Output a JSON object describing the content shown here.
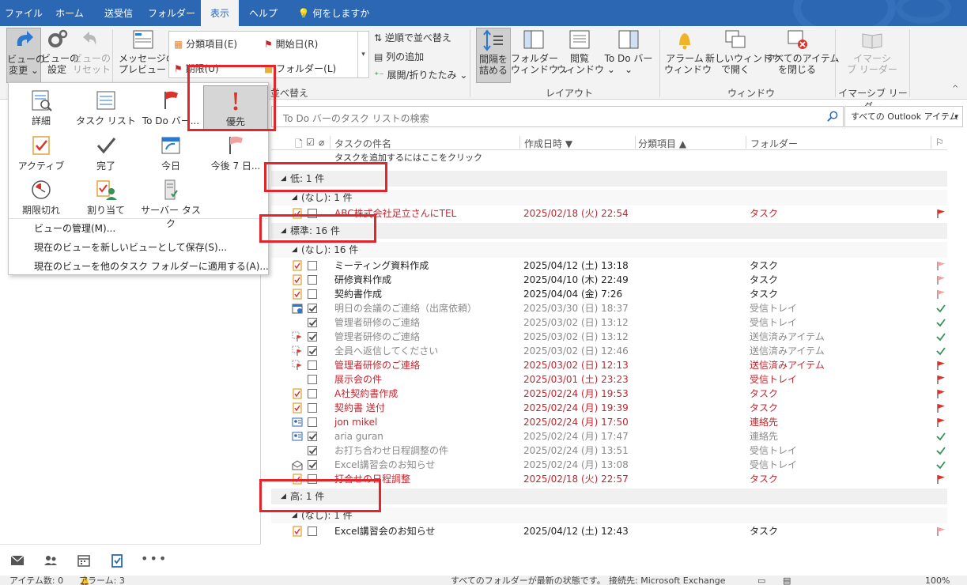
{
  "tabs": [
    "ファイル",
    "ホーム",
    "送受信",
    "フォルダー",
    "表示",
    "ヘルプ",
    "何をしますか"
  ],
  "ribbon": {
    "change_view": "ビューの\n変更 ⌄",
    "view_settings": "ビューの\n設定",
    "reset_view": "ビューの\nリセット",
    "message_preview": "メッセージの\nプレビュー ⌄",
    "arrangement": {
      "category": "分類項目(E)",
      "start_date": "開始日(R)",
      "due_date": "期限(U)",
      "folder": "フォルダー(L)"
    },
    "reverse_sort": "逆順で並べ替え",
    "add_columns": "列の追加",
    "expand_collapse": "展開/折りたたみ ⌄",
    "group_arrangement": "並べ替え",
    "compact": "間隔を\n詰める",
    "folder_pane": "フォルダー\nウィンドウ ⌄",
    "reading_pane": "閲覧\nウィンドウ ⌄",
    "todo_bar": "To Do バー\n⌄",
    "group_layout": "レイアウト",
    "reminders": "アラーム\nウィンドウ",
    "open_new_window": "新しいウィンドウ\nで開く",
    "close_all": "すべてのアイテム\nを閉じる",
    "group_window": "ウィンドウ",
    "immersive_reader": "イマーシ\nブ リーダー",
    "group_immersive": "イマーシブ リーダー"
  },
  "dropdown": {
    "items": [
      "詳細",
      "タスク リスト",
      "To Do バー...",
      "優先",
      "アクティブ",
      "完了",
      "今日",
      "今後 7 日...",
      "期限切れ",
      "割り当て",
      "サーバー タスク"
    ],
    "manage": "ビューの管理(M)...",
    "save_as": "現在のビューを新しいビューとして保存(S)...",
    "apply": "現在のビューを他のタスク フォルダーに適用する(A)..."
  },
  "search": {
    "placeholder": "To Do バーのタスク リストの検索",
    "scope": "すべての Outlook アイテム"
  },
  "columns": {
    "subject": "タスクの件名",
    "created": "作成日時",
    "category": "分類項目",
    "folder": "フォルダー"
  },
  "add_task": "タスクを追加するにはここをクリック",
  "groups": [
    {
      "label": "低: 1 件",
      "sub": "(なし): 1 件",
      "rows": [
        {
          "subject": "ABC株式会社足立さんにTEL",
          "date": "2025/02/18 (火) 22:54",
          "folder": "タスク",
          "style": "red",
          "checked": false,
          "icon": "task",
          "flag": "red"
        }
      ]
    },
    {
      "label": "標準: 16 件",
      "sub": "(なし): 16 件",
      "rows": [
        {
          "subject": "ミーティング資料作成",
          "date": "2025/04/12 (土) 13:18",
          "folder": "タスク",
          "style": "norm",
          "checked": false,
          "icon": "task",
          "flag": "pink"
        },
        {
          "subject": "研修資料作成",
          "date": "2025/04/10 (木) 22:49",
          "folder": "タスク",
          "style": "norm",
          "checked": false,
          "icon": "task",
          "flag": "pink"
        },
        {
          "subject": "契約書作成",
          "date": "2025/04/04 (金) 7:26",
          "folder": "タスク",
          "style": "norm",
          "checked": false,
          "icon": "task",
          "flag": "pink"
        },
        {
          "subject": "明日の会議のご連絡（出席依頼）",
          "date": "2025/03/30 (日) 18:37",
          "folder": "受信トレイ",
          "style": "done",
          "checked": true,
          "icon": "meeting",
          "flag": "check"
        },
        {
          "subject": "管理者研修のご連絡",
          "date": "2025/03/02 (日) 13:12",
          "folder": "受信トレイ",
          "style": "done",
          "checked": true,
          "icon": "none",
          "flag": "check"
        },
        {
          "subject": "管理者研修のご連絡",
          "date": "2025/03/02 (日) 13:12",
          "folder": "送信済みアイテム",
          "style": "done",
          "checked": true,
          "icon": "flagmail",
          "flag": "check"
        },
        {
          "subject": "全員へ返信してください",
          "date": "2025/03/02 (日) 12:46",
          "folder": "送信済みアイテム",
          "style": "done",
          "checked": true,
          "icon": "flagmail",
          "flag": "check"
        },
        {
          "subject": "管理者研修のご連絡",
          "date": "2025/03/02 (日) 12:13",
          "folder": "送信済みアイテム",
          "style": "red",
          "checked": false,
          "icon": "flagmail",
          "flag": "red"
        },
        {
          "subject": "展示会の件",
          "date": "2025/03/01 (土) 23:23",
          "folder": "受信トレイ",
          "style": "red",
          "checked": false,
          "icon": "none",
          "flag": "red"
        },
        {
          "subject": "A社契約書作成",
          "date": "2025/02/24 (月) 19:53",
          "folder": "タスク",
          "style": "red",
          "checked": false,
          "icon": "task",
          "flag": "red"
        },
        {
          "subject": "契約書  送付",
          "date": "2025/02/24 (月) 19:39",
          "folder": "タスク",
          "style": "red",
          "checked": false,
          "icon": "task",
          "flag": "red"
        },
        {
          "subject": "jon mikel",
          "date": "2025/02/24 (月) 17:50",
          "folder": "連絡先",
          "style": "red",
          "checked": false,
          "icon": "contact",
          "flag": "red"
        },
        {
          "subject": "aria guran",
          "date": "2025/02/24 (月) 17:47",
          "folder": "連絡先",
          "style": "done",
          "checked": true,
          "icon": "contact",
          "flag": "check"
        },
        {
          "subject": "お打ち合わせ日程調整の件",
          "date": "2025/02/24 (月) 13:51",
          "folder": "受信トレイ",
          "style": "done",
          "checked": true,
          "icon": "none",
          "flag": "check"
        },
        {
          "subject": "Excel講習会のお知らせ",
          "date": "2025/02/24 (月) 13:08",
          "folder": "受信トレイ",
          "style": "done",
          "checked": true,
          "icon": "openmail",
          "flag": "check"
        },
        {
          "subject": "打合せの日程調整",
          "date": "2025/02/18 (火) 22:57",
          "folder": "タスク",
          "style": "red",
          "checked": false,
          "icon": "task",
          "flag": "red"
        }
      ]
    },
    {
      "label": "高: 1 件",
      "sub": "(なし): 1 件",
      "rows": [
        {
          "subject": "Excel講習会のお知らせ",
          "date": "2025/04/12 (土) 12:43",
          "folder": "タスク",
          "style": "norm",
          "checked": false,
          "icon": "task",
          "flag": "pink"
        }
      ]
    }
  ],
  "status": {
    "items": "アイテム数: 0",
    "reminders": "アラーム: 3",
    "folders_state": "すべてのフォルダーが最新の状態です。",
    "connection": "接続先: Microsoft Exchange",
    "zoom": "100%"
  },
  "colors": {
    "accent": "#2b67b3",
    "overdue": "#c4262e",
    "highlight": "#e4262c",
    "done": "#3a8f5c"
  }
}
